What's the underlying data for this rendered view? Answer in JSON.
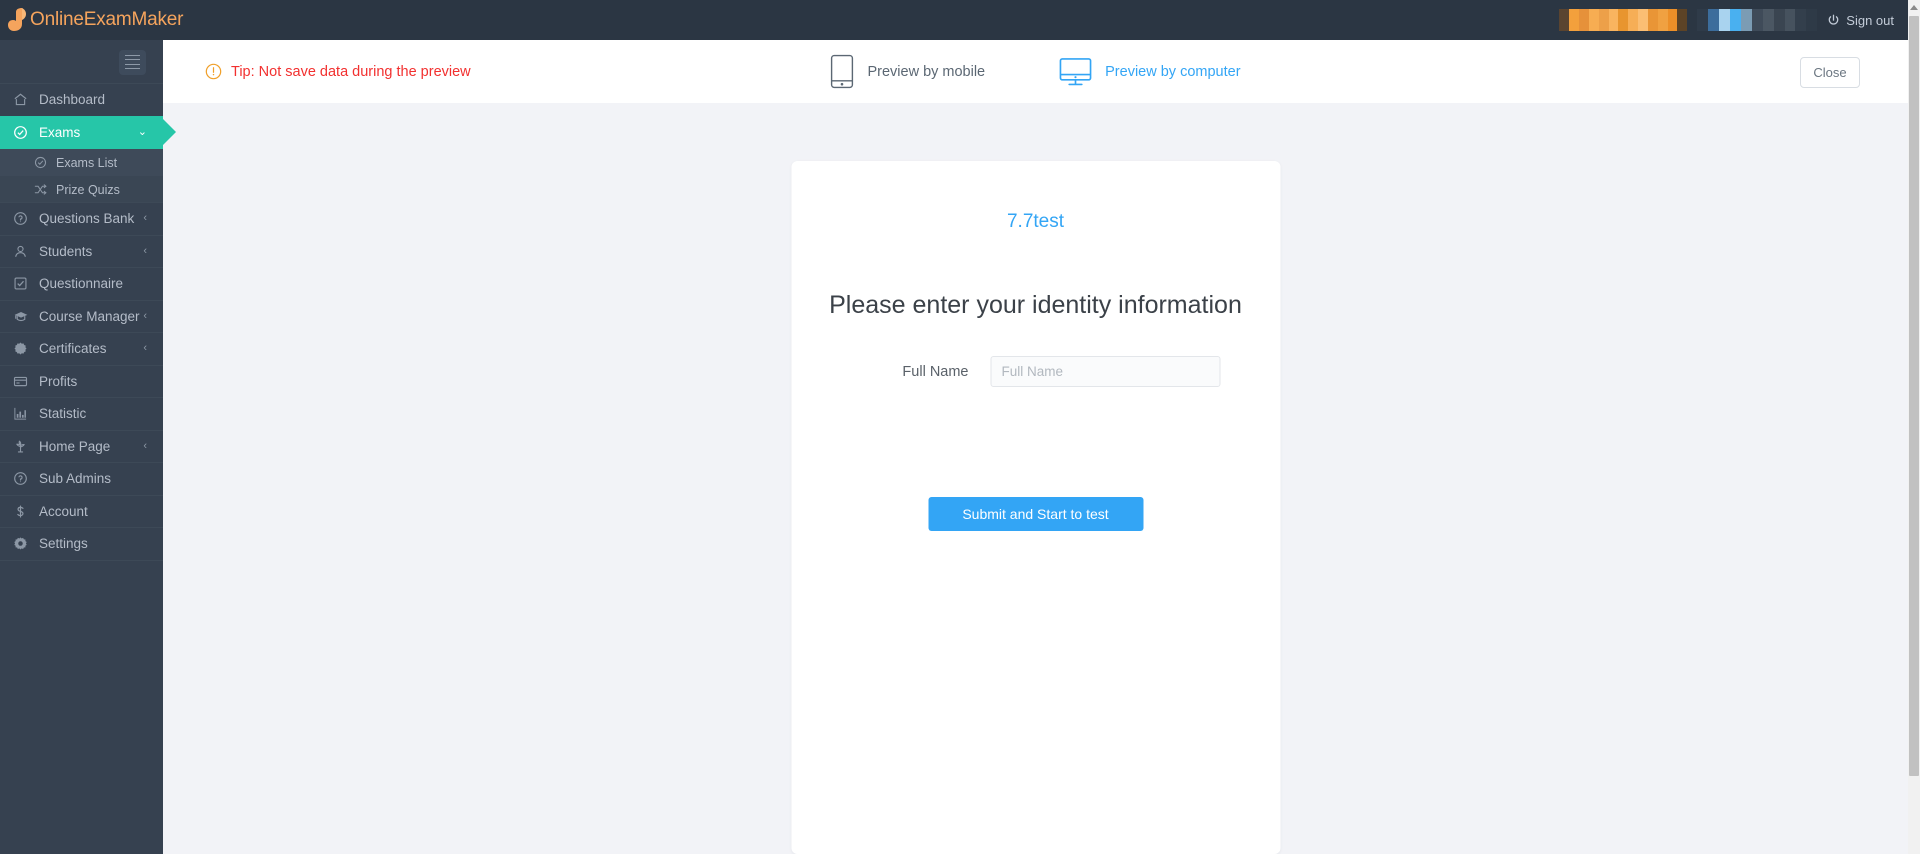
{
  "colors": {
    "brand_orange": "#f5a45d",
    "sidebar_bg": "#364150",
    "topbar_bg": "#2b3643",
    "active_green": "#26c6a8",
    "accent_blue": "#33a5f5",
    "tip_red": "#f2302f",
    "tip_icon_orange": "#f0a02a",
    "stage_bg": "#f2f3f7"
  },
  "topbar": {
    "brand_name": "OnlineExamMaker",
    "brand_icon": "leaf-logo-icon",
    "signout_label": "Sign out",
    "signout_icon": "power-icon"
  },
  "sidebar": {
    "toggle_icon": "hamburger-icon",
    "items": [
      {
        "label": "Dashboard",
        "icon": "home-icon",
        "arrow": "",
        "active": false
      },
      {
        "label": "Exams",
        "icon": "check-circle-icon",
        "arrow": "⌄",
        "active": true
      },
      {
        "label": "Questions Bank",
        "icon": "question-circle-icon",
        "arrow": "‹",
        "active": false
      },
      {
        "label": "Students",
        "icon": "user-icon",
        "arrow": "‹",
        "active": false
      },
      {
        "label": "Questionnaire",
        "icon": "checkbox-icon",
        "arrow": "",
        "active": false
      },
      {
        "label": "Course Manager",
        "icon": "graduation-cap-icon",
        "arrow": "‹",
        "active": false
      },
      {
        "label": "Certificates",
        "icon": "badge-icon",
        "arrow": "‹",
        "active": false
      },
      {
        "label": "Profits",
        "icon": "credit-card-icon",
        "arrow": "",
        "active": false
      },
      {
        "label": "Statistic",
        "icon": "bar-chart-icon",
        "arrow": "",
        "active": false
      },
      {
        "label": "Home Page",
        "icon": "plant-icon",
        "arrow": "‹",
        "active": false
      },
      {
        "label": "Sub Admins",
        "icon": "question-circle-icon",
        "arrow": "",
        "active": false
      },
      {
        "label": "Account",
        "icon": "dollar-icon",
        "arrow": "",
        "active": false
      },
      {
        "label": "Settings",
        "icon": "gear-icon",
        "arrow": "",
        "active": false
      }
    ],
    "submenu": [
      {
        "label": "Exams List",
        "icon": "check-circle-icon",
        "selected": true
      },
      {
        "label": "Prize Quizs",
        "icon": "shuffle-icon",
        "selected": false
      }
    ]
  },
  "preview_bar": {
    "tip_text": "Tip: Not save data during the preview",
    "tip_icon": "exclamation-circle-icon",
    "mobile_label": "Preview by mobile",
    "mobile_icon": "mobile-icon",
    "computer_label": "Preview by computer",
    "computer_icon": "monitor-icon",
    "close_label": "Close"
  },
  "exam_card": {
    "title": "7.7test",
    "heading": "Please enter your identity information",
    "full_name_label": "Full Name",
    "full_name_placeholder": "Full Name",
    "full_name_value": "",
    "submit_label": "Submit and Start to test"
  }
}
